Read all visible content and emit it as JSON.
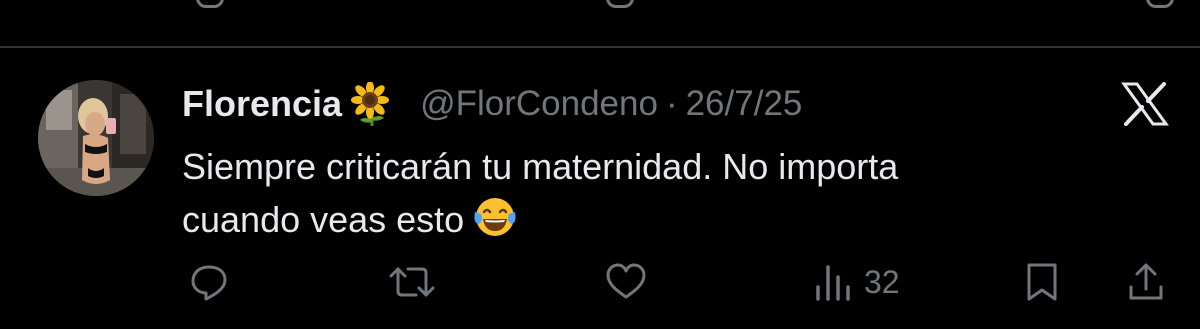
{
  "tweet": {
    "author_name": "Florencia",
    "handle": "@FlorCondeno",
    "separator": "·",
    "date": "26/7/25",
    "text_line1": "Siempre criticarán tu maternidad. No importa",
    "text_line2": "cuando veas esto"
  },
  "icons": {
    "name_emoji": "sunflower-emoji",
    "text_emoji": "tears-of-joy-emoji",
    "platform": "x-logo-icon",
    "reply": "reply-icon",
    "repost": "repost-icon",
    "like": "like-icon",
    "views": "views-icon",
    "bookmark": "bookmark-icon",
    "share": "share-icon"
  },
  "actions": {
    "views_count": "32"
  },
  "colors": {
    "background": "#000000",
    "text": "#e7e9ea",
    "secondary": "#71767b",
    "divider": "#2f3336"
  }
}
